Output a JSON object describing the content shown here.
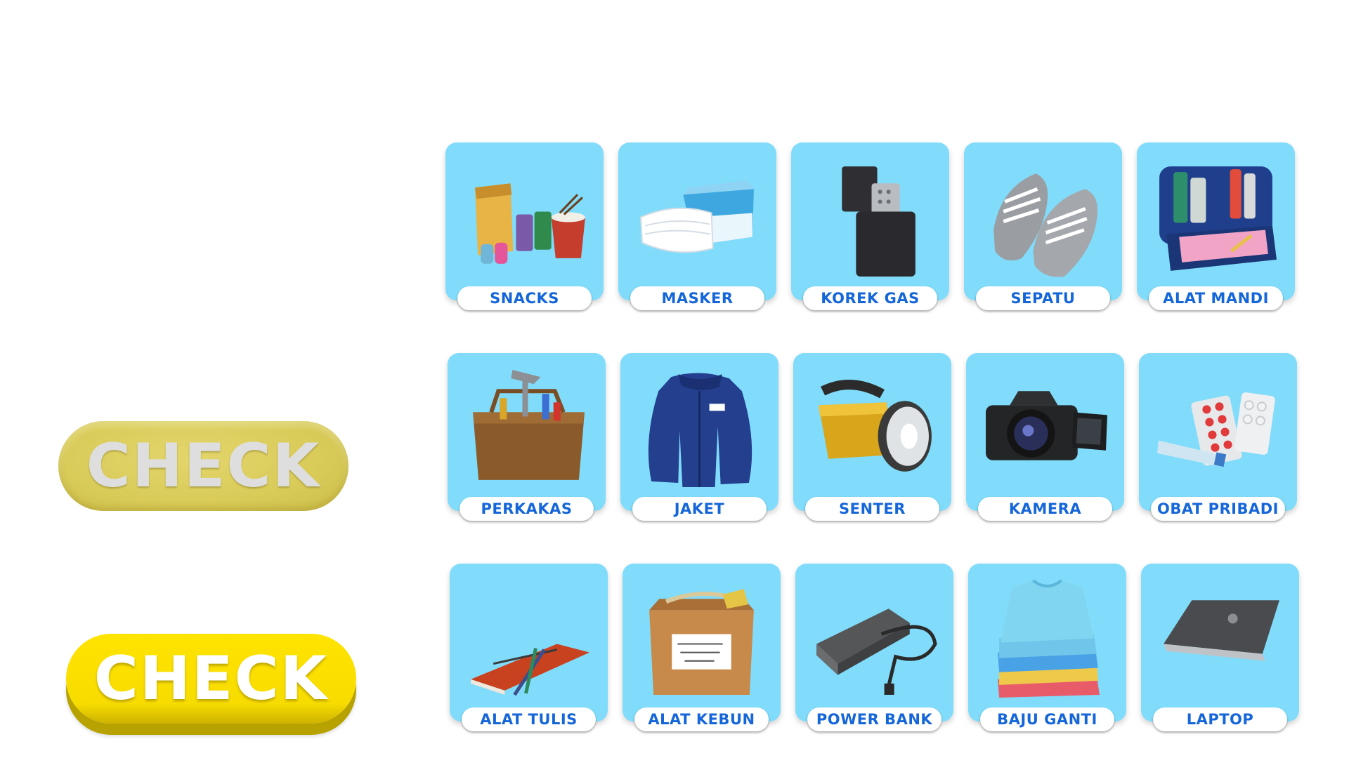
{
  "buttons": {
    "check_disabled_label": "CHECK",
    "check_active_label": "CHECK"
  },
  "items": [
    {
      "label": "SNACKS",
      "icon": "snacks-icon"
    },
    {
      "label": "MASKER",
      "icon": "mask-icon"
    },
    {
      "label": "KOREK GAS",
      "icon": "lighter-icon"
    },
    {
      "label": "SEPATU",
      "icon": "shoes-icon"
    },
    {
      "label": "ALAT MANDI",
      "icon": "toiletries-icon"
    },
    {
      "label": "PERKAKAS",
      "icon": "toolbox-icon"
    },
    {
      "label": "JAKET",
      "icon": "jacket-icon"
    },
    {
      "label": "SENTER",
      "icon": "flashlight-icon"
    },
    {
      "label": "KAMERA",
      "icon": "camera-icon"
    },
    {
      "label": "OBAT PRIBADI",
      "icon": "medicine-icon"
    },
    {
      "label": "ALAT TULIS",
      "icon": "stationery-icon"
    },
    {
      "label": "ALAT KEBUN",
      "icon": "garden-tools-icon"
    },
    {
      "label": "POWER BANK",
      "icon": "power-bank-icon"
    },
    {
      "label": "BAJU GANTI",
      "icon": "clothes-icon"
    },
    {
      "label": "LAPTOP",
      "icon": "laptop-icon"
    }
  ],
  "colors": {
    "card_bg": "#80dcfa",
    "label_text": "#1566d9",
    "check_active": "#ffe400",
    "check_disabled": "#d9cb58"
  }
}
